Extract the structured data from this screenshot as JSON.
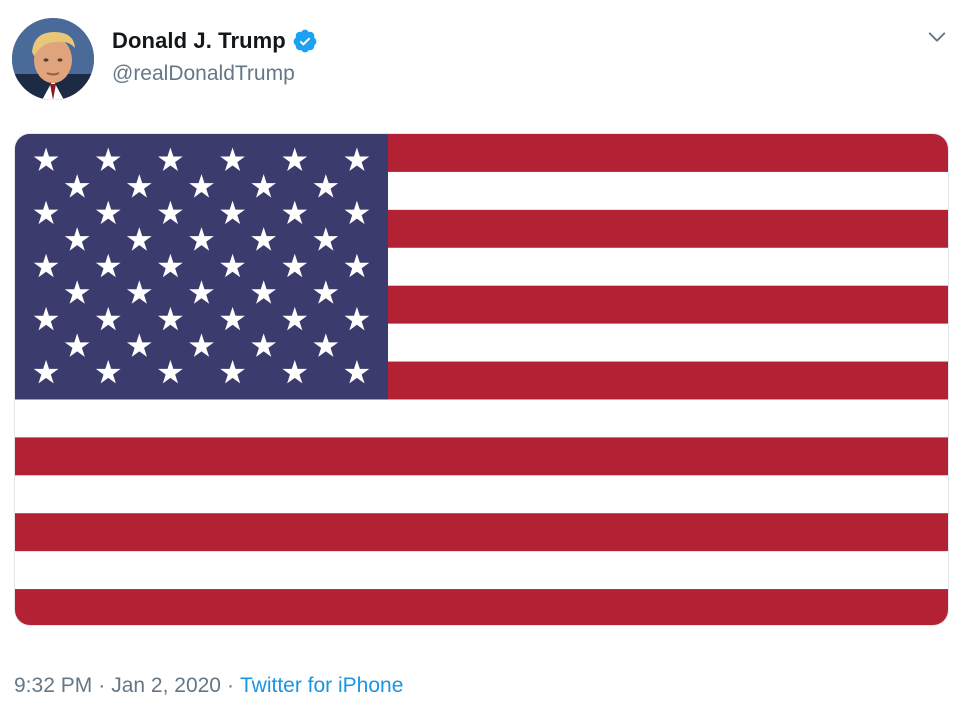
{
  "author": {
    "display_name": "Donald J. Trump",
    "handle": "@realDonaldTrump",
    "verified_icon": "verified-badge-icon",
    "avatar_icon": "avatar"
  },
  "media": {
    "type": "flag",
    "icon": "us-flag-image"
  },
  "meta": {
    "time": "9:32 PM",
    "separator": "·",
    "date": "Jan 2, 2020",
    "source": "Twitter for iPhone"
  },
  "menu": {
    "icon": "chevron-down-icon"
  },
  "colors": {
    "flag_red": "#b22234",
    "flag_blue": "#3c3b6e",
    "flag_white": "#ffffff",
    "link_blue": "#1b95e0",
    "verified_blue": "#1da1f2",
    "muted_text": "#657786",
    "name_text": "#14171a"
  }
}
